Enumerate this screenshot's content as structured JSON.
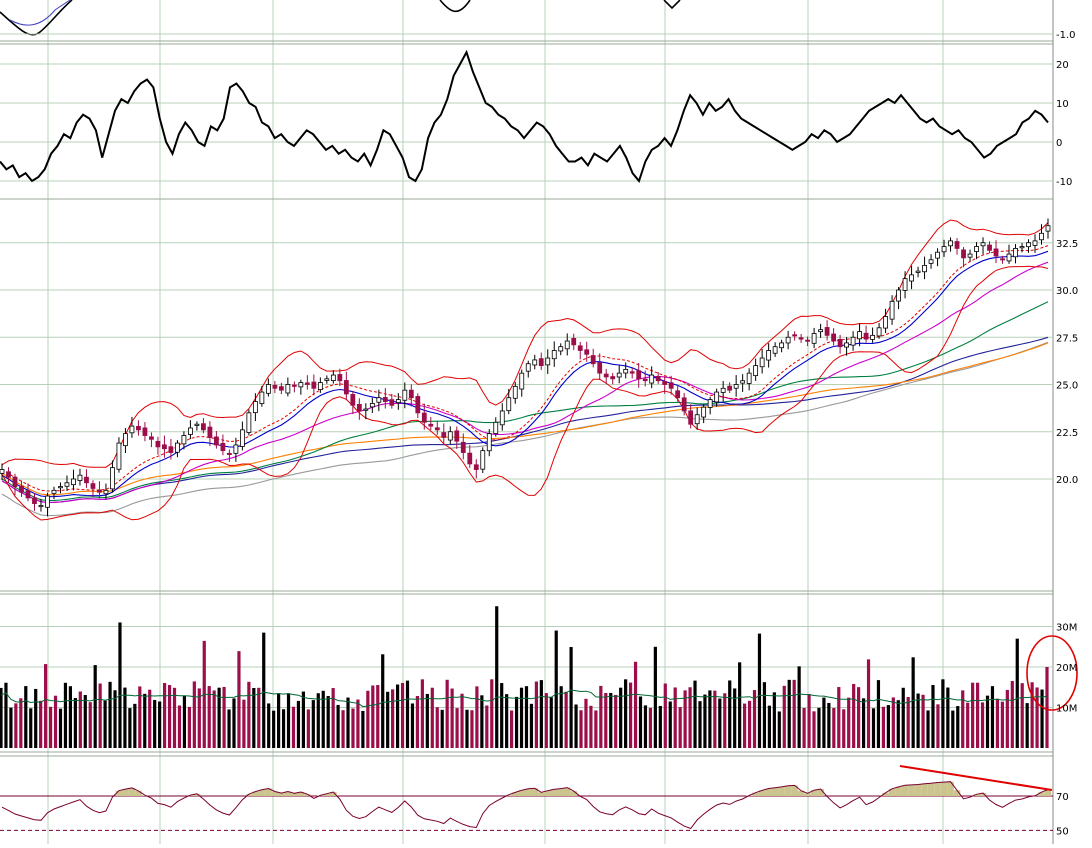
{
  "chart_data": [
    {
      "panel": "top-indicator",
      "type": "line",
      "tick_labels": [
        "-1.0"
      ],
      "visible_fragment": true
    },
    {
      "panel": "momentum",
      "type": "line",
      "ylim": [
        -12,
        24
      ],
      "tick_labels": [
        "20",
        "10",
        "0",
        "-10"
      ],
      "series": [
        {
          "values": [
            -5,
            -7,
            -6,
            -9,
            -8,
            -10,
            -9,
            -7,
            -3,
            -1,
            2,
            1,
            5,
            7,
            6,
            3,
            -4,
            2,
            8,
            11,
            10,
            13,
            15,
            16,
            14,
            6,
            0,
            -3,
            2,
            5,
            3,
            0,
            -1,
            4,
            3,
            6,
            14,
            15,
            13,
            10,
            9,
            5,
            4,
            1,
            2,
            0,
            -1,
            1,
            3,
            2,
            0,
            -2,
            -1,
            -3,
            -2,
            -4,
            -5,
            -3,
            -6,
            -2,
            3,
            2,
            -1,
            -4,
            -9,
            -10,
            -7,
            1,
            5,
            7,
            11,
            17,
            20,
            23,
            18,
            14,
            10,
            9,
            7,
            6,
            4,
            3,
            1,
            3,
            5,
            4,
            2,
            -1,
            -3,
            -5,
            -5,
            -4,
            -6,
            -3,
            -4,
            -5,
            -3,
            -1,
            -4,
            -8,
            -10,
            -5,
            -2,
            -1,
            1,
            -1,
            3,
            8,
            12,
            10,
            7,
            10,
            8,
            9,
            11,
            8,
            6,
            5,
            4,
            3,
            2,
            1,
            0,
            -1,
            -2,
            -1,
            0,
            2,
            1,
            3,
            2,
            0,
            1,
            2,
            4,
            6,
            8,
            9,
            10,
            11,
            10,
            12,
            10,
            8,
            6,
            5,
            6,
            4,
            3,
            2,
            3,
            1,
            0,
            -2,
            -4,
            -3,
            -1,
            0,
            1,
            2,
            5,
            6,
            8,
            7,
            5
          ],
          "color": "#000000"
        }
      ]
    },
    {
      "panel": "price",
      "type": "candlestick",
      "ylim": [
        18.1,
        33.6
      ],
      "tick_labels": [
        "32.5",
        "30.0",
        "27.5",
        "25.0",
        "22.5",
        "20.0"
      ],
      "series": [
        {
          "values": [
            20.5,
            20.1,
            19.6,
            19.3,
            19.0,
            18.7,
            18.6,
            19.1,
            19.4,
            19.6,
            19.8,
            20.0,
            20.2,
            19.8,
            19.5,
            19.3,
            19.4,
            20.6,
            21.9,
            22.4,
            22.8,
            22.6,
            22.3,
            22.1,
            21.7,
            21.6,
            21.4,
            21.9,
            22.3,
            22.7,
            22.9,
            22.6,
            22.2,
            21.8,
            21.5,
            21.3,
            21.8,
            22.6,
            23.5,
            24.1,
            24.6,
            25.0,
            24.8,
            24.7,
            25.0,
            24.9,
            25.1,
            25.0,
            24.8,
            25.1,
            25.3,
            25.5,
            25.2,
            24.5,
            23.9,
            23.6,
            23.7,
            24.0,
            24.3,
            24.1,
            23.9,
            24.2,
            24.7,
            24.3,
            23.5,
            23.0,
            22.8,
            22.6,
            22.2,
            22.5,
            22.0,
            21.4,
            20.8,
            20.5,
            21.5,
            22.4,
            23.0,
            23.6,
            24.3,
            24.9,
            25.6,
            26.1,
            26.3,
            26.0,
            26.4,
            26.8,
            27.0,
            27.3,
            27.1,
            26.8,
            26.6,
            26.1,
            25.6,
            25.4,
            25.3,
            25.6,
            25.8,
            25.6,
            25.3,
            25.2,
            25.5,
            25.2,
            25.0,
            24.8,
            24.3,
            23.6,
            22.9,
            23.4,
            23.8,
            24.2,
            24.6,
            24.8,
            24.7,
            25.0,
            25.2,
            25.6,
            26.0,
            26.4,
            26.8,
            27.0,
            27.2,
            27.5,
            27.6,
            27.4,
            27.3,
            27.7,
            27.9,
            27.6,
            27.3,
            27.0,
            27.2,
            27.5,
            27.8,
            27.4,
            27.6,
            28.0,
            28.6,
            29.4,
            30.0,
            30.6,
            30.8,
            31.0,
            31.3,
            31.6,
            32.0,
            32.3,
            32.6,
            32.2,
            31.7,
            31.9,
            32.3,
            32.5,
            32.1,
            31.8,
            31.6,
            31.9,
            32.2,
            32.3,
            32.5,
            32.6,
            33.0,
            33.4
          ],
          "color": "#000000",
          "down_color": "#9b0e4a"
        }
      ],
      "overlays": [
        {
          "kind": "bollinger",
          "color": "#e00000"
        },
        {
          "kind": "moving-average",
          "color": "#0000cc"
        },
        {
          "kind": "moving-average",
          "color": "#cc00cc"
        },
        {
          "kind": "moving-average",
          "color": "#008040"
        },
        {
          "kind": "moving-average",
          "color": "#ff8000"
        },
        {
          "kind": "moving-average",
          "color": "#999999"
        },
        {
          "kind": "moving-average",
          "color": "#22229a"
        }
      ]
    },
    {
      "panel": "volume",
      "type": "bar",
      "ylim": [
        0,
        34
      ],
      "tick_labels": [
        "30M",
        "20M",
        "10M"
      ],
      "unit": "M",
      "moving_average_color": "#006633",
      "up_color": "#000000",
      "down_color": "#9b0e4a",
      "annotation": {
        "kind": "circle",
        "color": "#e00000",
        "target": "last-bar"
      }
    },
    {
      "panel": "rsi",
      "type": "line",
      "ylim": [
        47,
        82
      ],
      "tick_labels": [
        "70",
        "50"
      ],
      "levels": [
        70,
        50
      ],
      "line_color": "#7a0030",
      "fill_above_70_color": "#cbc48e",
      "annotation": {
        "kind": "trend-line",
        "color": "#e00000",
        "direction": "down"
      }
    }
  ]
}
